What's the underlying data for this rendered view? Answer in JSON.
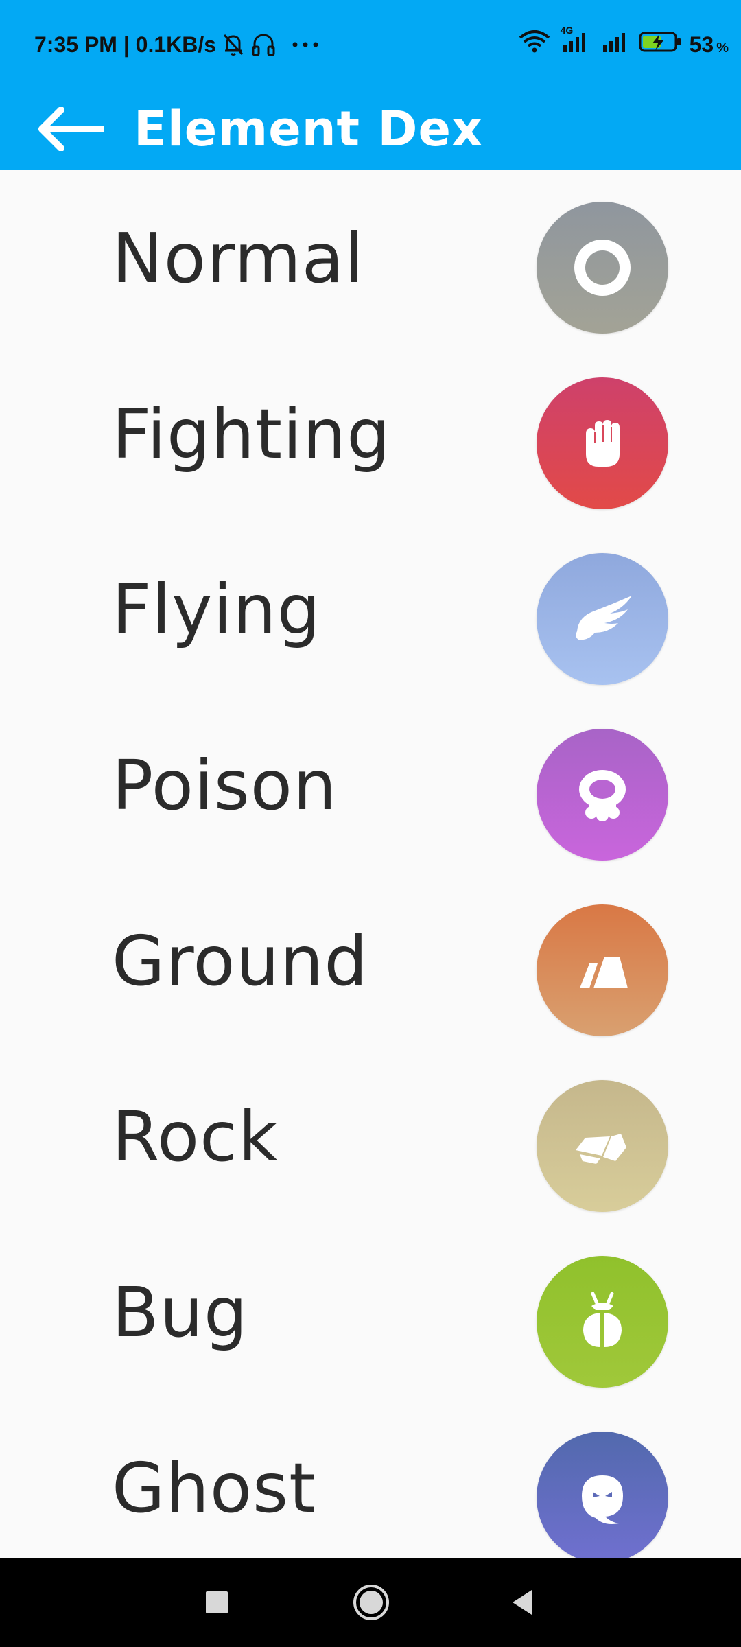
{
  "status_bar": {
    "time_speed": "7:35 PM | 0.1KB/s",
    "network_label": "4G",
    "battery_percent": "53",
    "battery_unit": "%"
  },
  "toolbar": {
    "title": "Element Dex"
  },
  "types": [
    {
      "name": "Normal",
      "icon": "ring-icon",
      "color_top": "#8f969e",
      "color_bottom": "#a3a396"
    },
    {
      "name": "Fighting",
      "icon": "fist-icon",
      "color_top": "#ce416b",
      "color_bottom": "#e24a48"
    },
    {
      "name": "Flying",
      "icon": "wing-icon",
      "color_top": "#8fa8dd",
      "color_bottom": "#a8c2f0"
    },
    {
      "name": "Poison",
      "icon": "skull-icon",
      "color_top": "#a864c7",
      "color_bottom": "#c965dc"
    },
    {
      "name": "Ground",
      "icon": "terrain-icon",
      "color_top": "#d97845",
      "color_bottom": "#d9a070"
    },
    {
      "name": "Rock",
      "icon": "rock-icon",
      "color_top": "#c5b78c",
      "color_bottom": "#d8cd9a"
    },
    {
      "name": "Bug",
      "icon": "bug-icon",
      "color_top": "#90c12c",
      "color_bottom": "#a0c83a"
    },
    {
      "name": "Ghost",
      "icon": "ghost-icon",
      "color_top": "#5269ad",
      "color_bottom": "#7070d0"
    }
  ]
}
